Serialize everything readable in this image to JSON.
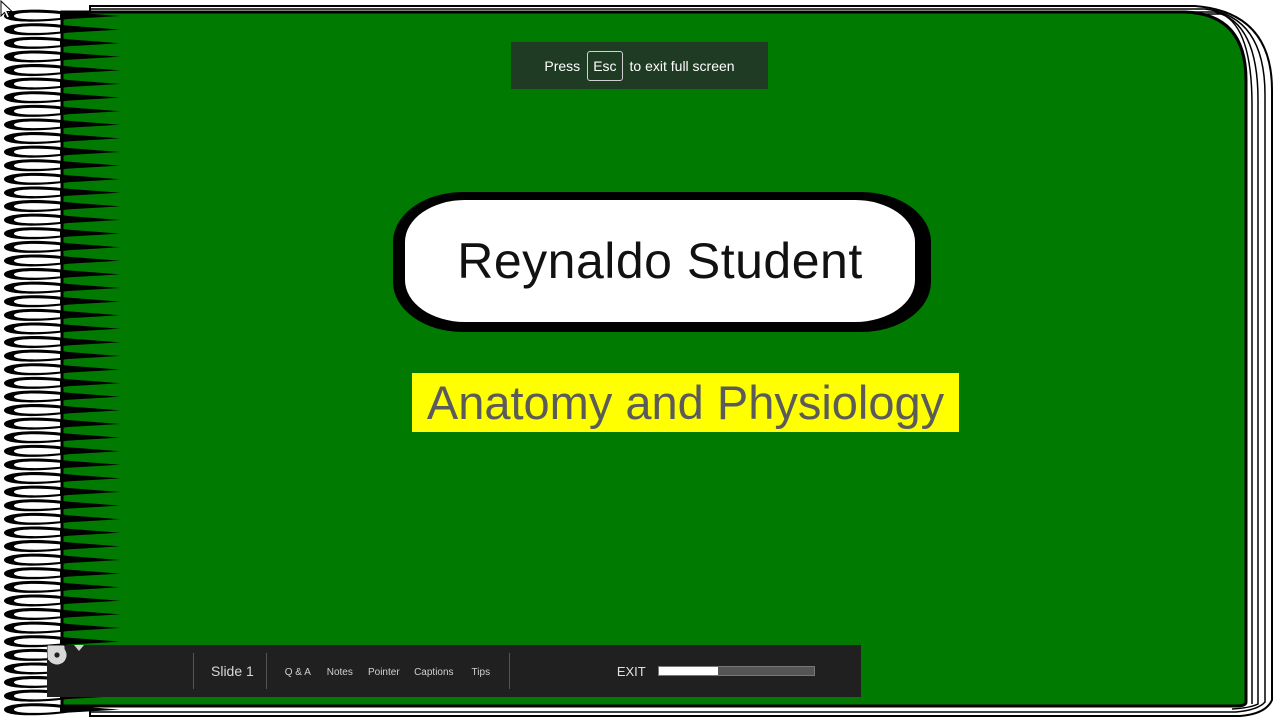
{
  "fullscreen_hint": {
    "press": "Press",
    "key": "Esc",
    "rest": "to exit full screen"
  },
  "slide": {
    "title": "Reynaldo Student",
    "subtitle": "Anatomy and Physiology",
    "colors": {
      "background": "#007a00",
      "subtitle_highlight": "#ffff00",
      "subtitle_text": "#5b5b5b"
    }
  },
  "toolbar": {
    "prev_icon": "chevron-left-icon",
    "play_icon": "play-icon",
    "next_icon": "chevron-right-icon",
    "slide_selector": "Slide 1",
    "tools": [
      {
        "label": "Q & A",
        "icon": "chat-icon"
      },
      {
        "label": "Notes",
        "icon": "notes-icon"
      },
      {
        "label": "Pointer",
        "icon": "pointer-icon"
      },
      {
        "label": "Captions",
        "icon": "captions-icon"
      },
      {
        "label": "Tips",
        "icon": "info-icon"
      }
    ],
    "exit_fullscreen_icon": "exit-fullscreen-icon",
    "settings_icon": "gear-icon",
    "exit_label": "EXIT",
    "progress": 0.38
  }
}
